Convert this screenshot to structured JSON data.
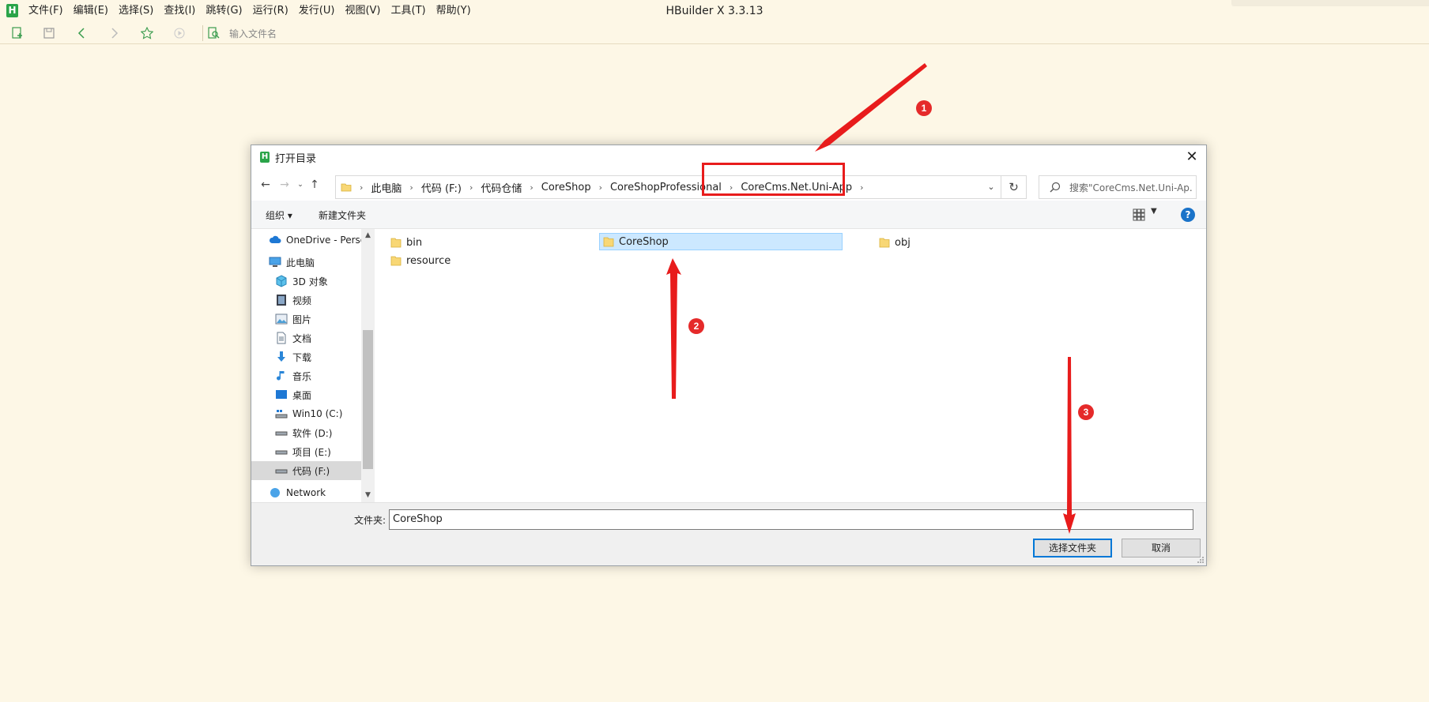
{
  "app": {
    "title": "HBuilder X 3.3.13",
    "logo_letter": "H",
    "menu": [
      "文件(F)",
      "编辑(E)",
      "选择(S)",
      "查找(I)",
      "跳转(G)",
      "运行(R)",
      "发行(U)",
      "视图(V)",
      "工具(T)",
      "帮助(Y)"
    ],
    "file_search_placeholder": "输入文件名"
  },
  "dialog": {
    "title": "打开目录",
    "breadcrumbs": [
      "此电脑",
      "代码 (F:)",
      "代码仓储",
      "CoreShop",
      "CoreShopProfessional",
      "CoreCms.Net.Uni-App"
    ],
    "search_placeholder": "搜索\"CoreCms.Net.Uni-Ap...",
    "organize_label": "组织 ▾",
    "new_folder_label": "新建文件夹",
    "help_label": "?",
    "nav_items": [
      {
        "label": "OneDrive - Perso",
        "icon": "cloud-icon"
      },
      {
        "label": "此电脑",
        "icon": "computer-icon"
      },
      {
        "label": "3D 对象",
        "icon": "cube-icon"
      },
      {
        "label": "视频",
        "icon": "video-icon"
      },
      {
        "label": "图片",
        "icon": "picture-icon"
      },
      {
        "label": "文档",
        "icon": "document-icon"
      },
      {
        "label": "下载",
        "icon": "download-icon"
      },
      {
        "label": "音乐",
        "icon": "music-icon"
      },
      {
        "label": "桌面",
        "icon": "desktop-icon"
      },
      {
        "label": "Win10 (C:)",
        "icon": "system-drive-icon"
      },
      {
        "label": "软件 (D:)",
        "icon": "drive-icon"
      },
      {
        "label": "项目 (E:)",
        "icon": "drive-icon"
      },
      {
        "label": "代码 (F:)",
        "icon": "drive-icon"
      },
      {
        "label": "Network",
        "icon": "network-icon"
      }
    ],
    "selected_nav_index": 12,
    "files": [
      "bin",
      "CoreShop",
      "obj",
      "resource"
    ],
    "selected_file": "CoreShop",
    "folder_label": "文件夹:",
    "folder_value": "CoreShop",
    "select_button": "选择文件夹",
    "cancel_button": "取消"
  },
  "annotations": [
    "1",
    "2",
    "3"
  ],
  "colors": {
    "background": "#fdf7e6",
    "brand_green": "#2aa449",
    "selection": "#cce8ff",
    "annotation_red": "#e52a2a",
    "primary_border": "#0078d7"
  }
}
